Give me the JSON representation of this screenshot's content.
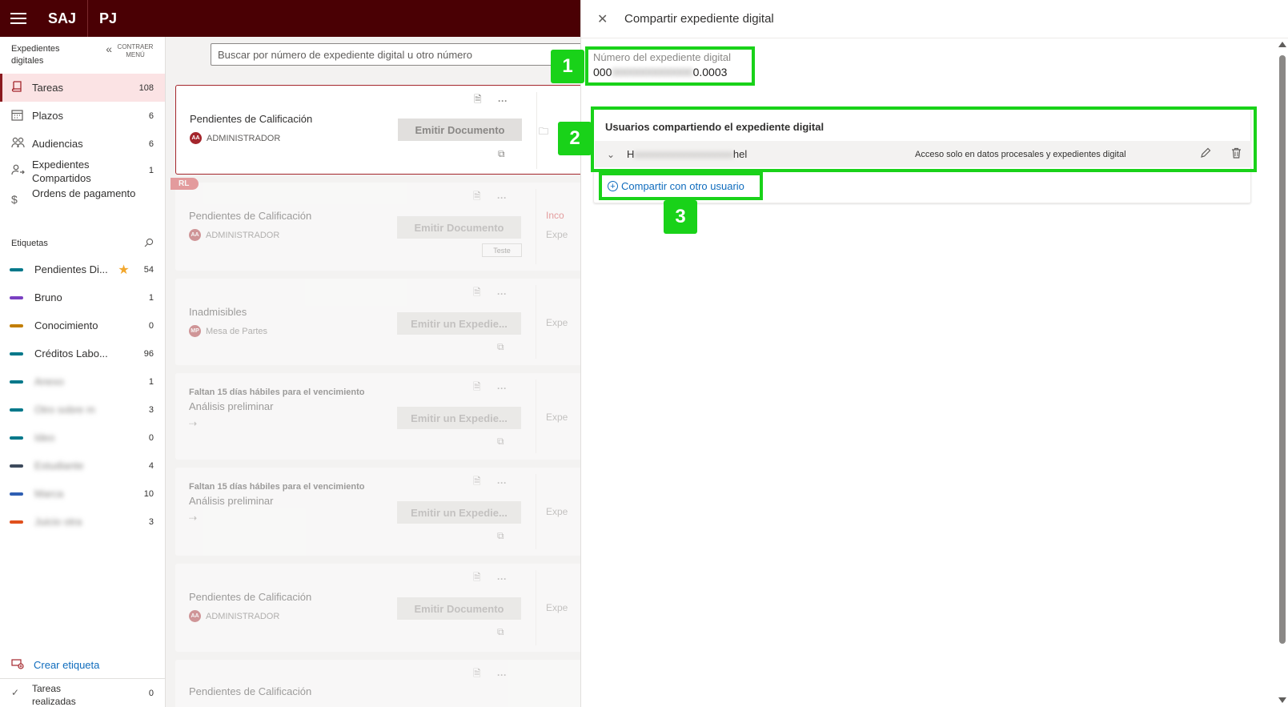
{
  "topbar": {
    "brand1": "SAJ",
    "brand2": "PJ"
  },
  "sidebar": {
    "title": "Expedientes digitales",
    "collapse_label": "CONTRAER MENÚ",
    "nav": [
      {
        "label": "Tareas",
        "count": "108",
        "icon": "book-icon"
      },
      {
        "label": "Plazos",
        "count": "6",
        "icon": "calendar-icon"
      },
      {
        "label": "Audiencias",
        "count": "6",
        "icon": "people-icon"
      },
      {
        "label": "Expedientes Compartidos",
        "count": "1",
        "icon": "shared-person-icon"
      },
      {
        "label": "Ordens de pagamento",
        "count": "",
        "icon": "dollar-icon"
      }
    ],
    "labels_title": "Etiquetas",
    "tags": [
      {
        "label": "Pendientes Di...",
        "count": "54",
        "color": "#00788a",
        "star": true
      },
      {
        "label": "Bruno",
        "count": "1",
        "color": "#7a3fc2"
      },
      {
        "label": "Conocimiento",
        "count": "0",
        "color": "#c27e00"
      },
      {
        "label": "Créditos Labo...",
        "count": "96",
        "color": "#00788a"
      },
      {
        "label": "Anexo",
        "count": "1",
        "color": "#00788a",
        "blurred": true
      },
      {
        "label": "Otro sobre m",
        "count": "3",
        "color": "#00788a",
        "blurred": true
      },
      {
        "label": "Ideo",
        "count": "0",
        "color": "#00788a",
        "blurred": true
      },
      {
        "label": "Estudiante",
        "count": "4",
        "color": "#3d4a5c",
        "blurred": true
      },
      {
        "label": "Marca",
        "count": "10",
        "color": "#2f5fb3",
        "blurred": true
      },
      {
        "label": "Juicio otra",
        "count": "3",
        "color": "#e0501d",
        "blurred": true
      }
    ],
    "create_tag": "Crear etiqueta",
    "done_tasks": "Tareas realizadas",
    "done_count": "0"
  },
  "main": {
    "search_placeholder": "Buscar por número de expediente digital u otro número",
    "cards": [
      {
        "title": "Pendientes de Calificación",
        "sub": "ADMINISTRADOR",
        "avatar": "AA",
        "button": "Emitir Documento",
        "right": ""
      },
      {
        "title": "Pendientes de Calificación",
        "sub": "ADMINISTRADOR",
        "avatar": "AA",
        "button": "Emitir Documento",
        "tag": "RL",
        "small_btn": "Teste",
        "right1": "Inco",
        "right2": "Expe"
      },
      {
        "title": "Inadmisibles",
        "sub": "Mesa de Partes",
        "avatar": "MP",
        "button": "Emitir un Expedie...",
        "right": "Expe"
      },
      {
        "pre": "Faltan 15 días hábiles para el vencimiento",
        "title": "Análisis preliminar",
        "button": "Emitir un Expedie...",
        "right": "Expe"
      },
      {
        "pre": "Faltan 15 días hábiles para el vencimiento",
        "title": "Análisis preliminar",
        "button": "Emitir un Expedie...",
        "right": "Expe"
      },
      {
        "title": "Pendientes de Calificación",
        "sub": "ADMINISTRADOR",
        "avatar": "AA",
        "button": "Emitir Documento",
        "right": "Expe"
      },
      {
        "title": "Pendientes de Calificación"
      }
    ]
  },
  "panel": {
    "title": "Compartir expediente digital",
    "field_label": "Número del expediente digital",
    "field_prefix": "000",
    "field_hidden": "0000000000000",
    "field_suffix": "0.0003",
    "share_title": "Usuarios compartiendo el expediente digital",
    "user_prefix": "H",
    "user_hidden": "xxxxxxxxxxxxxxxxxxx",
    "user_suffix": "hel",
    "user_access": "Acceso solo en datos procesales y expedientes digital",
    "share_link": "Compartir con otro usuario"
  },
  "callouts": [
    "1",
    "2",
    "3"
  ],
  "colors": {
    "topbar": "#4a0004",
    "accent": "#a4262c",
    "highlight": "#19d219",
    "link": "#0f6cbd"
  }
}
